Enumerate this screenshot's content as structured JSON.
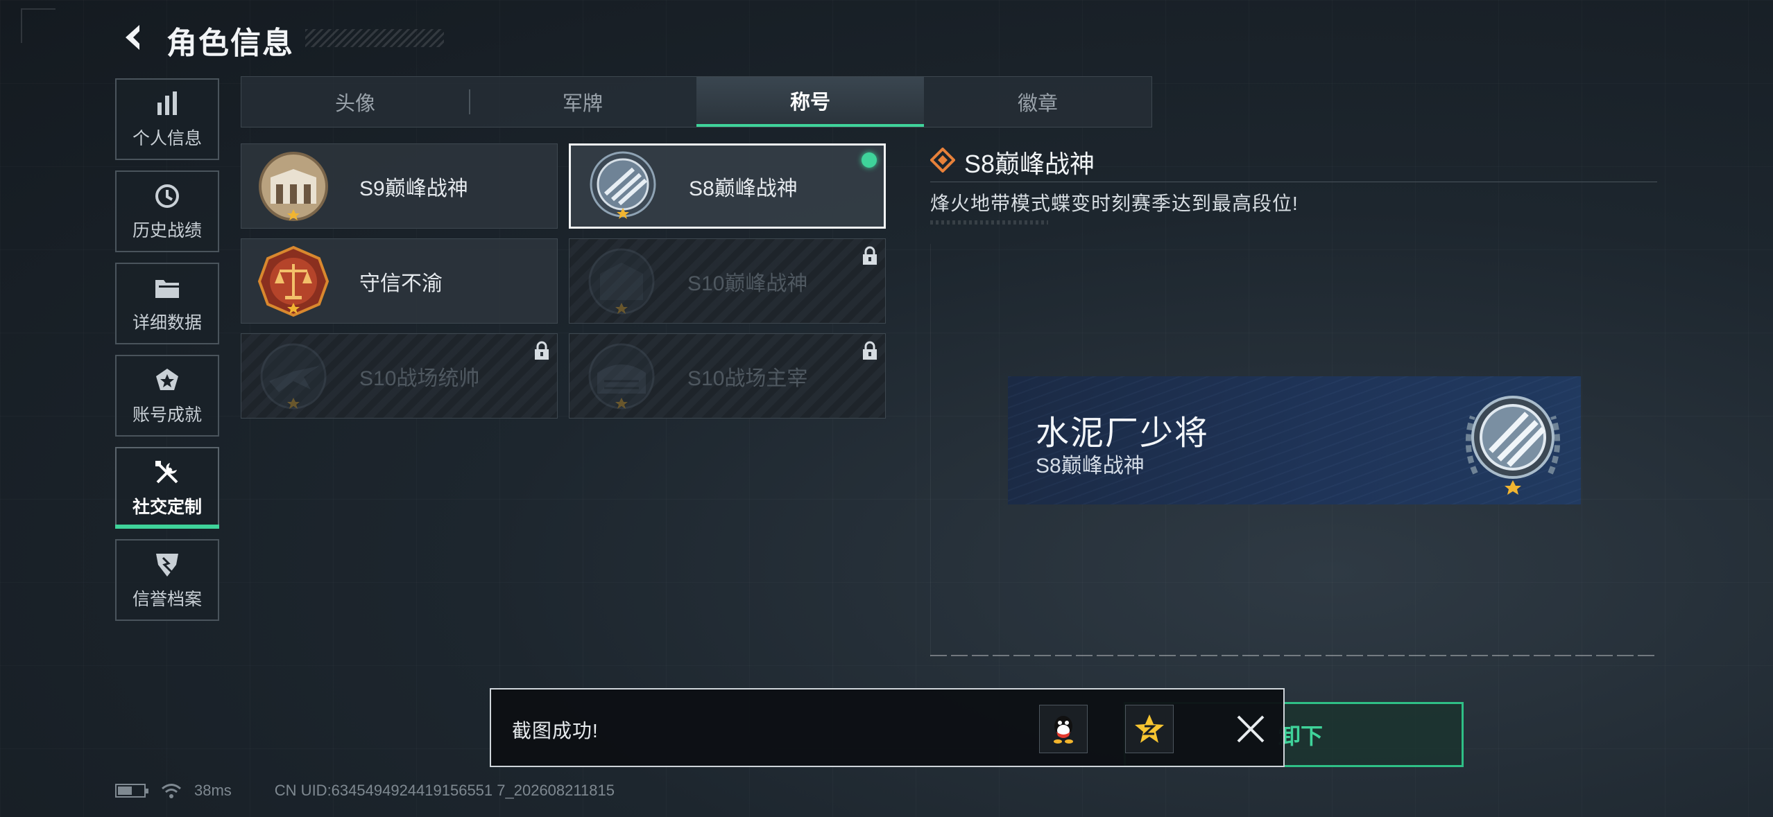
{
  "header": {
    "title": "角色信息"
  },
  "sidebar": {
    "items": [
      {
        "label": "个人信息",
        "icon": "bar-chart-icon",
        "active": false
      },
      {
        "label": "历史战绩",
        "icon": "history-icon",
        "active": false
      },
      {
        "label": "详细数据",
        "icon": "folder-icon",
        "active": false
      },
      {
        "label": "账号成就",
        "icon": "achievement-icon",
        "active": false
      },
      {
        "label": "社交定制",
        "icon": "tools-icon",
        "active": true
      },
      {
        "label": "信誉档案",
        "icon": "shield-icon",
        "active": false
      }
    ]
  },
  "tabs": [
    {
      "label": "头像",
      "active": false
    },
    {
      "label": "军牌",
      "active": false
    },
    {
      "label": "称号",
      "active": true
    },
    {
      "label": "徽章",
      "active": false
    }
  ],
  "titles": [
    {
      "name": "S9巅峰战神",
      "emblem": "arch-emblem",
      "state": "owned"
    },
    {
      "name": "S8巅峰战神",
      "emblem": "shield-emblem",
      "state": "equipped"
    },
    {
      "name": "守信不渝",
      "emblem": "scales-emblem",
      "state": "owned"
    },
    {
      "name": "S10巅峰战神",
      "emblem": "arch-emblem",
      "state": "locked"
    },
    {
      "name": "S10战场统帅",
      "emblem": "jet-emblem",
      "state": "locked"
    },
    {
      "name": "S10战场主宰",
      "emblem": "colosseum-emblem",
      "state": "locked"
    }
  ],
  "detail": {
    "title": "S8巅峰战神",
    "description": "烽火地带模式蝶变时刻赛季达到最高段位!"
  },
  "nameplate": {
    "player_name": "水泥厂少将",
    "title": "S8巅峰战神"
  },
  "action_button": {
    "label": "卸下"
  },
  "toast": {
    "message": "截图成功!"
  },
  "status": {
    "ping": "38ms",
    "uid": "CN UID:6345494924419156551 7_202608211815"
  },
  "colors": {
    "accent": "#3fd39a",
    "star": "#f1b531",
    "nameplate": "#1f3458"
  }
}
